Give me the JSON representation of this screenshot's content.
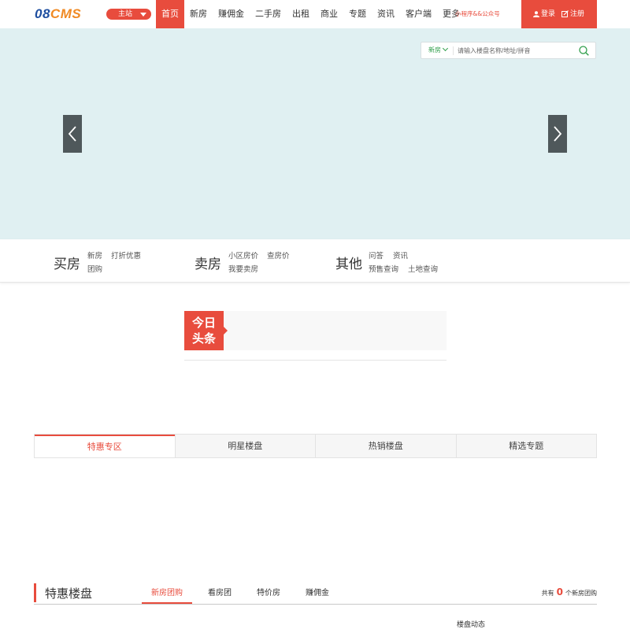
{
  "header": {
    "logo": {
      "part1": "08",
      "part2": "CMS"
    },
    "site_switch": "主站",
    "nav": [
      {
        "label": "首页",
        "active": true
      },
      {
        "label": "新房"
      },
      {
        "label": "赚佣金"
      },
      {
        "label": "二手房"
      },
      {
        "label": "出租"
      },
      {
        "label": "商业"
      },
      {
        "label": "专题"
      },
      {
        "label": "资讯"
      },
      {
        "label": "客户端"
      },
      {
        "label": "更多"
      }
    ],
    "note": "小程序&&公众号",
    "login": "登录",
    "register": "注册"
  },
  "banner": {
    "search": {
      "type": "新房",
      "placeholder": "请输入楼盘名称/地址/拼音"
    }
  },
  "categories": [
    {
      "title": "买房",
      "links": [
        "新房",
        "打折优惠",
        "团购"
      ]
    },
    {
      "title": "卖房",
      "links": [
        "小区房价",
        "查房价",
        "我要卖房"
      ]
    },
    {
      "title": "其他",
      "links": [
        "问答",
        "资讯",
        "预售查询",
        "土地查询"
      ]
    }
  ],
  "headline": {
    "tag_line1": "今日",
    "tag_line2": "头条"
  },
  "tabs": [
    {
      "label": "特惠专区",
      "active": true
    },
    {
      "label": "明星楼盘"
    },
    {
      "label": "热销楼盘"
    },
    {
      "label": "精选专题"
    }
  ],
  "section": {
    "title": "特惠楼盘",
    "tabs": [
      {
        "label": "新房团购",
        "active": true
      },
      {
        "label": "看房团"
      },
      {
        "label": "特价房"
      },
      {
        "label": "赚佣金"
      }
    ],
    "count_prefix": "共有",
    "count": "0",
    "count_suffix": "个新房团购",
    "hint": "楼盘动态"
  },
  "colors": {
    "accent": "#e84c3d",
    "banner_bg": "#e0f0f2",
    "search_type": "#2e9e4a"
  }
}
